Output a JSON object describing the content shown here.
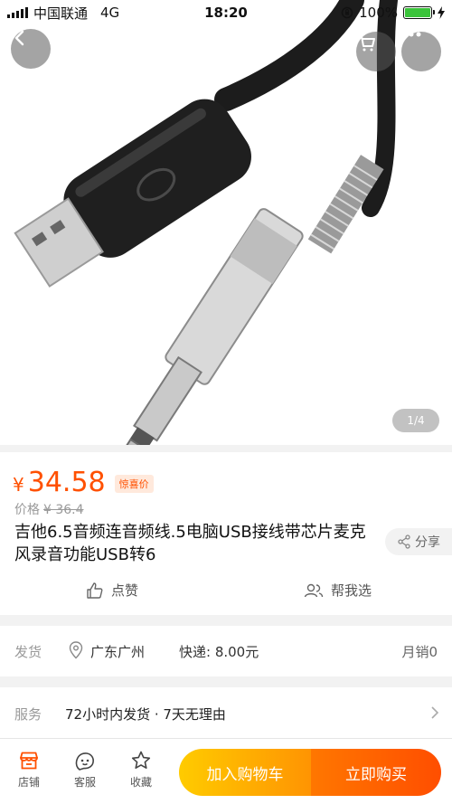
{
  "status_bar": {
    "carrier": "中国联通",
    "network": "4G",
    "time": "18:20",
    "battery": "100%",
    "battery_level": 1.0,
    "icons": [
      "signal-icon",
      "orientation-lock-icon",
      "battery-icon",
      "charging-icon"
    ]
  },
  "gallery": {
    "pager": "1/4",
    "icons": [
      "back-icon",
      "cart-icon",
      "more-icon"
    ]
  },
  "product": {
    "currency": "¥",
    "price": "34.58",
    "deal_tag": "惊喜价",
    "orig_label": "价格",
    "orig_price": "¥ 36.4",
    "title": "吉他6.5音频连音频线.5电脑USB接线带芯片麦克风录音功能USB转6",
    "share": "分享",
    "like": "点赞",
    "help": "帮我选"
  },
  "shipping": {
    "label": "发货",
    "location": "广东广州",
    "fee": "快递: 8.00元",
    "monthly": "月销0"
  },
  "service": {
    "label": "服务",
    "text": "72小时内发货 · 7天无理由"
  },
  "bottom_bar": {
    "store": "店铺",
    "customer_service": "客服",
    "favorite": "收藏",
    "add_to_cart": "加入购物车",
    "buy_now": "立即购买"
  },
  "colors": {
    "price": "#ff5000",
    "cart_button": "#ff9402",
    "buy_button": "#ff4e00",
    "store_icon": "#ff5000"
  }
}
